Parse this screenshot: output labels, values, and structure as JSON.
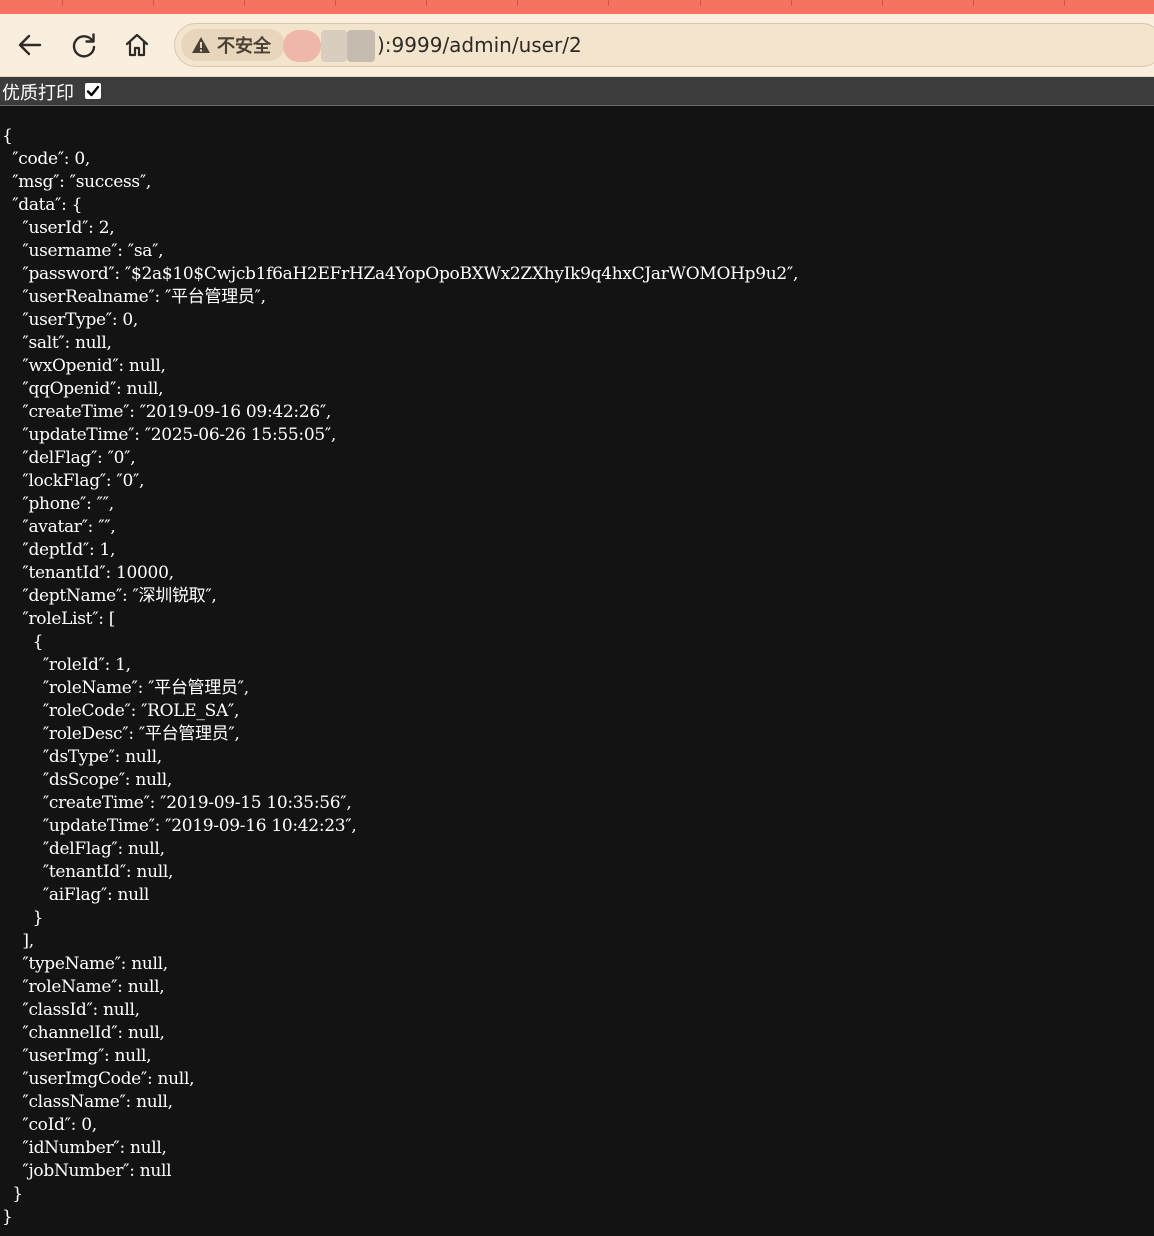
{
  "browser": {
    "security_label": "不安全",
    "url": "):9999/admin/user/2",
    "icons": {
      "back": "back-arrow-icon",
      "reload": "reload-icon",
      "home": "home-icon",
      "security": "warning-triangle-icon"
    },
    "colors": {
      "tabstrip": "#f4725f",
      "toolbar": "#faefdf",
      "omnibox": "#f3e4cd"
    }
  },
  "print_option": {
    "label": "优质打印",
    "checked": true
  },
  "response": {
    "code": 0,
    "msg": "success",
    "data": {
      "userId": 2,
      "username": "sa",
      "password": "$2a$10$Cwjcb1f6aH2EFrHZa4YopOpoBXWx2ZXhyIk9q4hxCJarWOMOHp9u2",
      "userRealname": "平台管理员",
      "userType": 0,
      "salt": null,
      "wxOpenid": null,
      "qqOpenid": null,
      "createTime": "2019-09-16 09:42:26",
      "updateTime": "2025-06-26 15:55:05",
      "delFlag": "0",
      "lockFlag": "0",
      "phone": "",
      "avatar": "",
      "deptId": 1,
      "tenantId": 10000,
      "deptName": "深圳锐取",
      "roleList": [
        {
          "roleId": 1,
          "roleName": "平台管理员",
          "roleCode": "ROLE_SA",
          "roleDesc": "平台管理员",
          "dsType": null,
          "dsScope": null,
          "createTime": "2019-09-15 10:35:56",
          "updateTime": "2019-09-16 10:42:23",
          "delFlag": null,
          "tenantId": null,
          "aiFlag": null
        }
      ],
      "typeName": null,
      "roleName": null,
      "classId": null,
      "channelId": null,
      "userImg": null,
      "userImgCode": null,
      "className": null,
      "coId": 0,
      "idNumber": null,
      "jobNumber": null
    }
  }
}
